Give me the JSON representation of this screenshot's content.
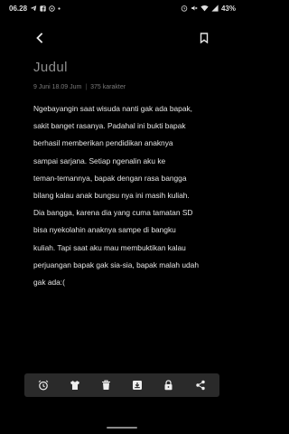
{
  "status_bar": {
    "time": "06.28",
    "battery": "43%",
    "left_icons": [
      "telegram-icon",
      "facebook-icon",
      "notification-icon",
      "dot-icon"
    ],
    "right_icons": [
      "alarm-icon",
      "mute-icon",
      "wifi-icon",
      "signal-icon",
      "battery-icon"
    ]
  },
  "toolbar": {
    "back_icon": "arrow-left-icon",
    "bookmark_icon": "bookmark-icon"
  },
  "note": {
    "title": "Judul",
    "date": "9 Juni 18.09 Jum",
    "separator": "|",
    "char_count": "375 karakter",
    "body": "Ngebayangin saat wisuda nanti gak ada bapak,\nsakit banget rasanya. Padahal ini bukti bapak\nberhasil memberikan pendidikan anaknya\nsampai sarjana. Setiap ngenalin aku ke\nteman-temannya, bapak dengan rasa bangga\nbilang kalau anak bungsu nya ini masih kuliah.\nDia bangga, karena dia yang cuma tamatan SD\nbisa nyekolahin anaknya sampe di bangku\nkuliah. Tapi saat aku mau membuktikan kalau\nperjuangan bapak gak sia-sia, bapak malah udah\ngak ada:("
  },
  "bottom_bar": {
    "icons": [
      "alarm-clock-icon",
      "shirt-icon",
      "trash-icon",
      "download-icon",
      "lock-icon",
      "share-icon"
    ]
  },
  "colors": {
    "background": "#000000",
    "text": "#e6e6e6",
    "muted": "#7a7a7a",
    "bottom_bar": "#2a2a2a"
  }
}
